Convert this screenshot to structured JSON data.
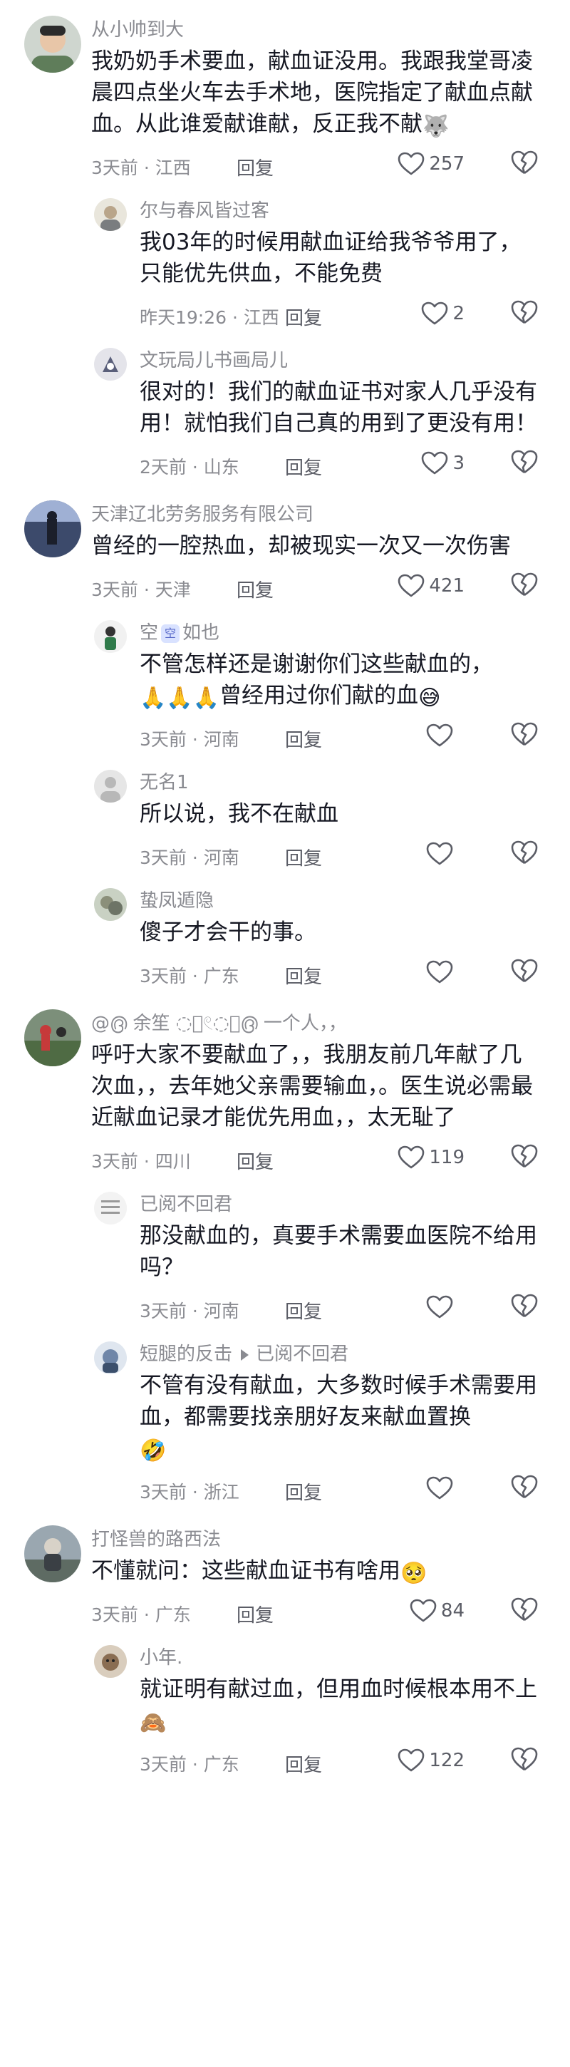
{
  "comments": [
    {
      "name": "从小帅到大",
      "text": "我奶奶手术要血，献血证没用。我跟我堂哥凌晨四点坐火车去手术地，医院指定了献血点献血。从此谁爱献谁献，反正我不献",
      "emoji": "🐺",
      "time": "3天前 · 江西",
      "reply_label": "回复",
      "likes": "257",
      "replies": [
        {
          "name": "尔与春风皆过客",
          "text": "我03年的时候用献血证给我爷爷用了，只能优先供血，不能免费",
          "time": "昨天19:26 · 江西",
          "reply_label": "回复",
          "likes": "2"
        },
        {
          "name": "文玩局儿书画局儿",
          "text": "很对的！我们的献血证书对家人几乎没有用！就怕我们自己真的用到了更没有用！",
          "time": "2天前 · 山东",
          "reply_label": "回复",
          "likes": "3"
        }
      ]
    },
    {
      "name": "天津辽北劳务服务有限公司",
      "text": "曾经的一腔热血，却被现实一次又一次伤害",
      "time": "3天前 · 天津",
      "reply_label": "回复",
      "likes": "421",
      "replies": [
        {
          "name_a": "空",
          "name_badge": "空",
          "name_b": "如也",
          "text": "不管怎样还是谢谢你们这些献血的，",
          "emoji_a": "🙏🙏🙏",
          "text_b": "曾经用过你们献的血",
          "emoji_b": "😅",
          "time": "3天前 · 河南",
          "reply_label": "回复",
          "likes": ""
        },
        {
          "name": "无名1",
          "text": "所以说，我不在献血",
          "time": "3天前 · 河南",
          "reply_label": "回复",
          "likes": ""
        },
        {
          "name": "蛰凤遁隐",
          "text": "傻子才会干的事。",
          "time": "3天前 · 广东",
          "reply_label": "回复",
          "likes": ""
        }
      ]
    },
    {
      "name": "@൫ 余笙 ◌⃘𓏲◌⃘൫ 一个人，，",
      "text": "呼吁大家不要献血了，，我朋友前几年献了几次血，，去年她父亲需要输血，。医生说必需最近献血记录才能优先用血，，太无耻了",
      "time": "3天前 · 四川",
      "reply_label": "回复",
      "likes": "119",
      "replies": [
        {
          "name": "已阅不回君",
          "text": "那没献血的，真要手术需要血医院不给用吗？",
          "time": "3天前 · 河南",
          "reply_label": "回复",
          "likes": ""
        },
        {
          "name": "短腿的反击",
          "reply_to": "已阅不回君",
          "text": "不管有没有献血，大多数时候手术需要用血，都需要找亲朋好友来献血置换",
          "emoji": "🤣",
          "time": "3天前 · 浙江",
          "reply_label": "回复",
          "likes": ""
        }
      ]
    },
    {
      "name": "打怪兽的路西法",
      "text": "不懂就问：这些献血证书有啥用",
      "emoji": "🥺",
      "time": "3天前 · 广东",
      "reply_label": "回复",
      "likes": "84",
      "replies": [
        {
          "name": "小年.",
          "text": "就证明有献过血，但用血时候根本用不上",
          "emoji": "🙈",
          "time": "3天前 · 广东",
          "reply_label": "回复",
          "likes": "122"
        }
      ]
    }
  ],
  "icons": {
    "like": "heart-outline-icon",
    "dislike": "broken-heart-outline-icon"
  },
  "colors": {
    "name": "#8a8b91",
    "text": "#161823",
    "meta": "#8a8b91"
  }
}
